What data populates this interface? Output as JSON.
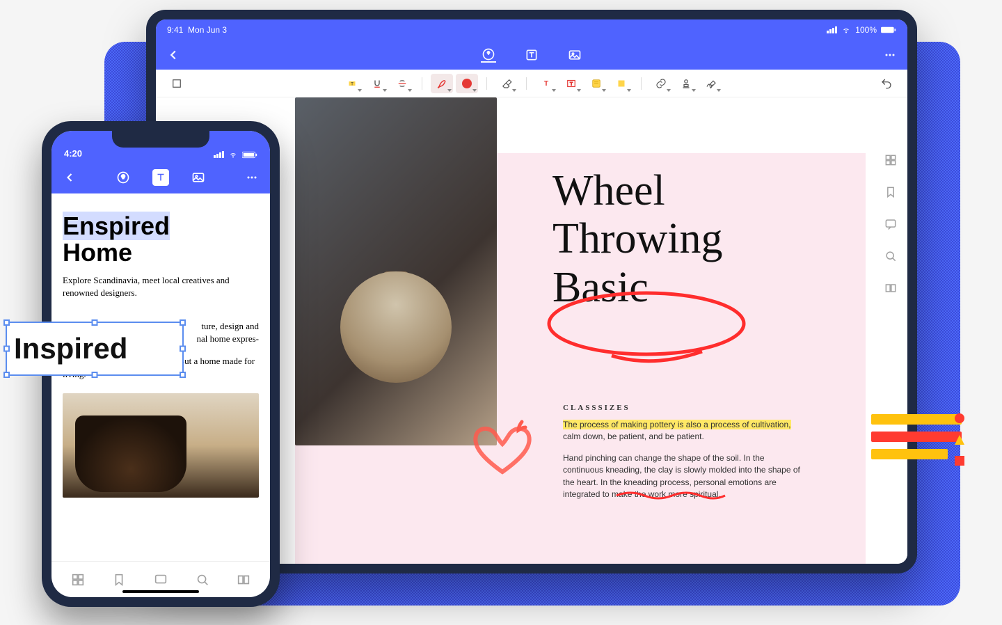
{
  "tablet": {
    "status": {
      "time": "9:41",
      "date": "Mon Jun 3",
      "battery": "100%"
    },
    "doc": {
      "title_line1": "Wheel",
      "title_line2": "Throwing",
      "title_line3": "Basic",
      "subhead": "CLASSSIZES",
      "para1_hilite": "The process of making pottery is also a process of cultivation,",
      "para1_rest": " calm down, be patient, and be patient.",
      "para2": "Hand pinching can change the shape of the soil. In the continuous kneading, the clay is slowly molded into the shape of the heart. In the kneading process, personal emotions are integrated to make the work more spiritual."
    }
  },
  "phone": {
    "status": {
      "time": "4:20"
    },
    "doc": {
      "h1_sel": "Enspired",
      "h1_rest": "Home",
      "para1": "Explore Scandinavia, meet local creatives and renowned designers.",
      "para2_a": "",
      "para2_b": "ture, design and",
      "para2_c": "nal home expres-",
      "para3": "Not a space built on perfection. But a home made for living."
    }
  },
  "floating": {
    "text": "Inspired"
  }
}
